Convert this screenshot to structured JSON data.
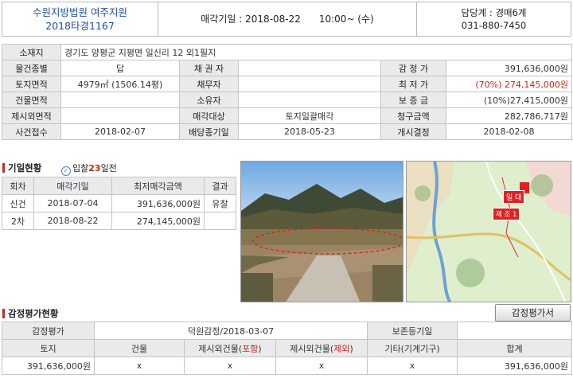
{
  "header": {
    "court": "수원지방법원 여주지원",
    "case_no": "2018타경1167",
    "sale_date_label": "매각기일",
    "sale_date_value": "2018-08-22",
    "sale_time": "10:00~ (수)",
    "dept_label": "담당계",
    "dept_value": "경매6계",
    "phone": "031-880-7450"
  },
  "info": {
    "address_label": "소재지",
    "address": "경기도 양평군 지평면 일신리 12 외1필지",
    "type_label": "물건종별",
    "type_value": "답",
    "creditor_label": "채 권 자",
    "creditor_value": "",
    "appraisal_label": "감 정 가",
    "appraisal_value": "391,636,000원",
    "land_label": "토지면적",
    "land_value": "4979㎡ (1506.14평)",
    "debtor_label": "채무자",
    "debtor_value": "",
    "min_price_label": "최 저 가",
    "min_price_value": "(70%) 274,145,000원",
    "bldg_label": "건물면적",
    "bldg_value": "",
    "owner_label": "소유자",
    "owner_value": "",
    "deposit_label": "보 증 금",
    "deposit_value": "(10%)27,415,000원",
    "excluded_label": "제시외면적",
    "excluded_value": "",
    "target_label": "매각대상",
    "target_value": "토지일괄매각",
    "claim_label": "청구금액",
    "claim_value": "282,786,717원",
    "received_label": "사건접수",
    "received_value": "2018-02-07",
    "dividend_label": "배당종기일",
    "dividend_value": "2018-05-23",
    "commence_label": "개시결정",
    "commence_value": "2018-02-08"
  },
  "history": {
    "title": "기일현황",
    "bid_prefix": "입찰",
    "bid_days": "23",
    "bid_suffix": "일전",
    "columns": [
      "회차",
      "매각기일",
      "최저매각금액",
      "결과"
    ],
    "rows": [
      {
        "round": "신건",
        "date": "2018-07-04",
        "price": "391,636,000원",
        "result": "유찰"
      },
      {
        "round": "2차",
        "date": "2018-08-22",
        "price": "274,145,000원",
        "result": ""
      }
    ]
  },
  "map": {
    "marker_1": "일 대",
    "marker_2": "제 조 1"
  },
  "appraisal": {
    "title": "감정평가현황",
    "button": "감정평가서",
    "appraiser_label": "감정평가",
    "appraiser_value": "덕원감정/2018-03-07",
    "preserve_label": "보존등기일",
    "preserve_value": "",
    "col_land": "토지",
    "col_bldg": "건물",
    "col_ext_incl_pre": "제시외건물(",
    "col_ext_incl_red": "포함",
    "col_ext_excl_pre": "제시외건물(",
    "col_ext_excl_red": "제외",
    "col_close": ")",
    "col_etc": "기타(기계기구)",
    "col_total": "합계",
    "val_land": "391,636,000원",
    "val_bldg": "x",
    "val_ext_incl": "x",
    "val_ext_excl": "x",
    "val_etc": "x",
    "val_total": "391,636,000원"
  },
  "colors": {
    "accent_red": "#c8251e",
    "court_blue": "#1d4fa8",
    "label_bg": "#e9eaeb"
  }
}
